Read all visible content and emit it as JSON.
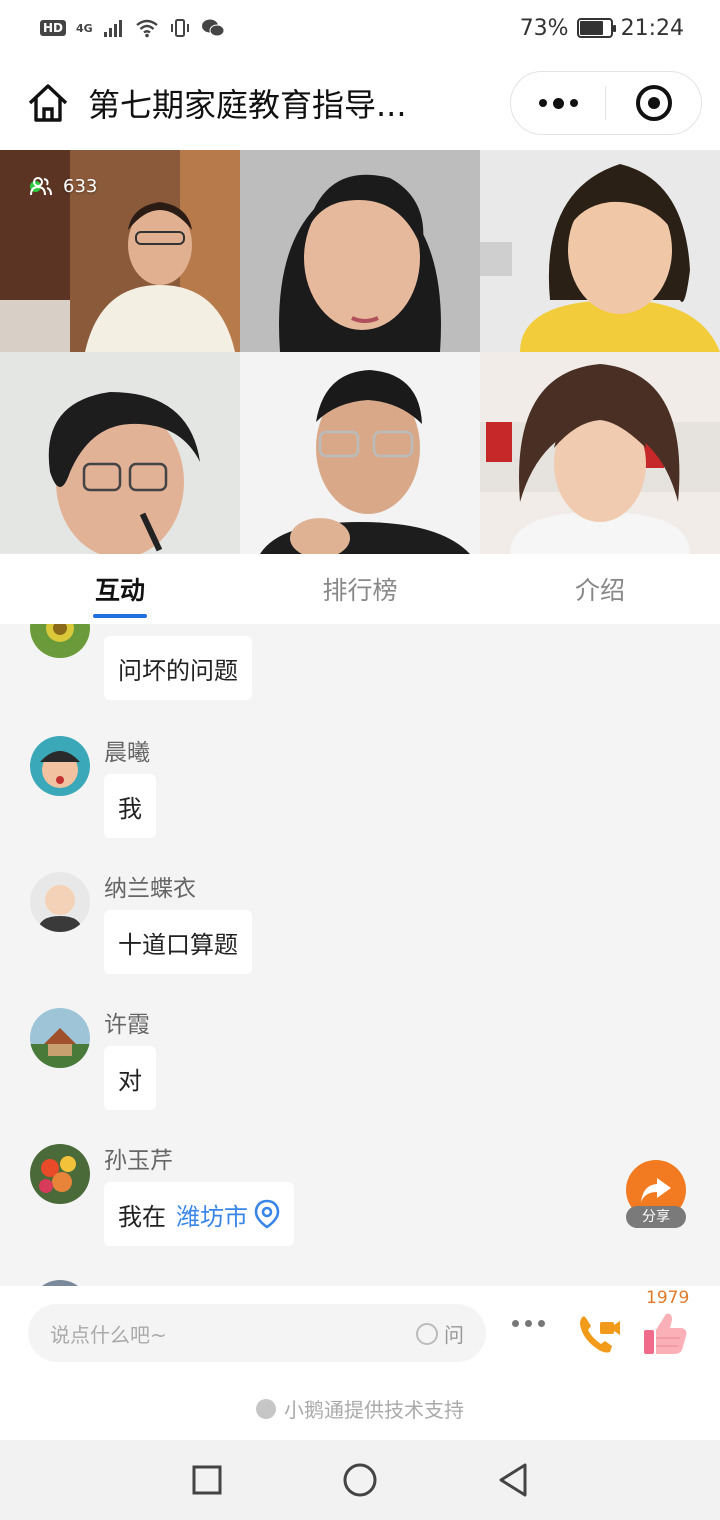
{
  "status_bar": {
    "network_hd": "HD",
    "network_4g": "4G",
    "battery_percent": "73%",
    "time": "21:24"
  },
  "title_bar": {
    "title": "第七期家庭教育指导..."
  },
  "video": {
    "viewer_count": "633",
    "tiles": [
      "host-tile",
      "guest-2",
      "guest-3",
      "guest-4",
      "guest-5",
      "guest-6"
    ]
  },
  "tabs": [
    {
      "label": "互动",
      "active": true
    },
    {
      "label": "排行榜",
      "active": false
    },
    {
      "label": "介绍",
      "active": false
    }
  ],
  "messages": [
    {
      "user": "",
      "text": "问坏的问题"
    },
    {
      "user": "晨曦",
      "text": "我"
    },
    {
      "user": "纳兰蝶衣",
      "text": "十道口算题"
    },
    {
      "user": "许霞",
      "text": "对"
    },
    {
      "user": "孙玉芹",
      "text": "我在",
      "location": "潍坊市"
    }
  ],
  "share": {
    "label": "分享"
  },
  "input": {
    "placeholder": "说点什么吧~",
    "ask_label": "问"
  },
  "likes": {
    "count": "1979"
  },
  "footer": {
    "powered_by": "小鹅通提供技术支持"
  },
  "colors": {
    "accent": "#1f6fe5",
    "link": "#3a86e8",
    "share": "#f27b22",
    "phone": "#f29a1a",
    "like_count": "#e07b2a"
  }
}
